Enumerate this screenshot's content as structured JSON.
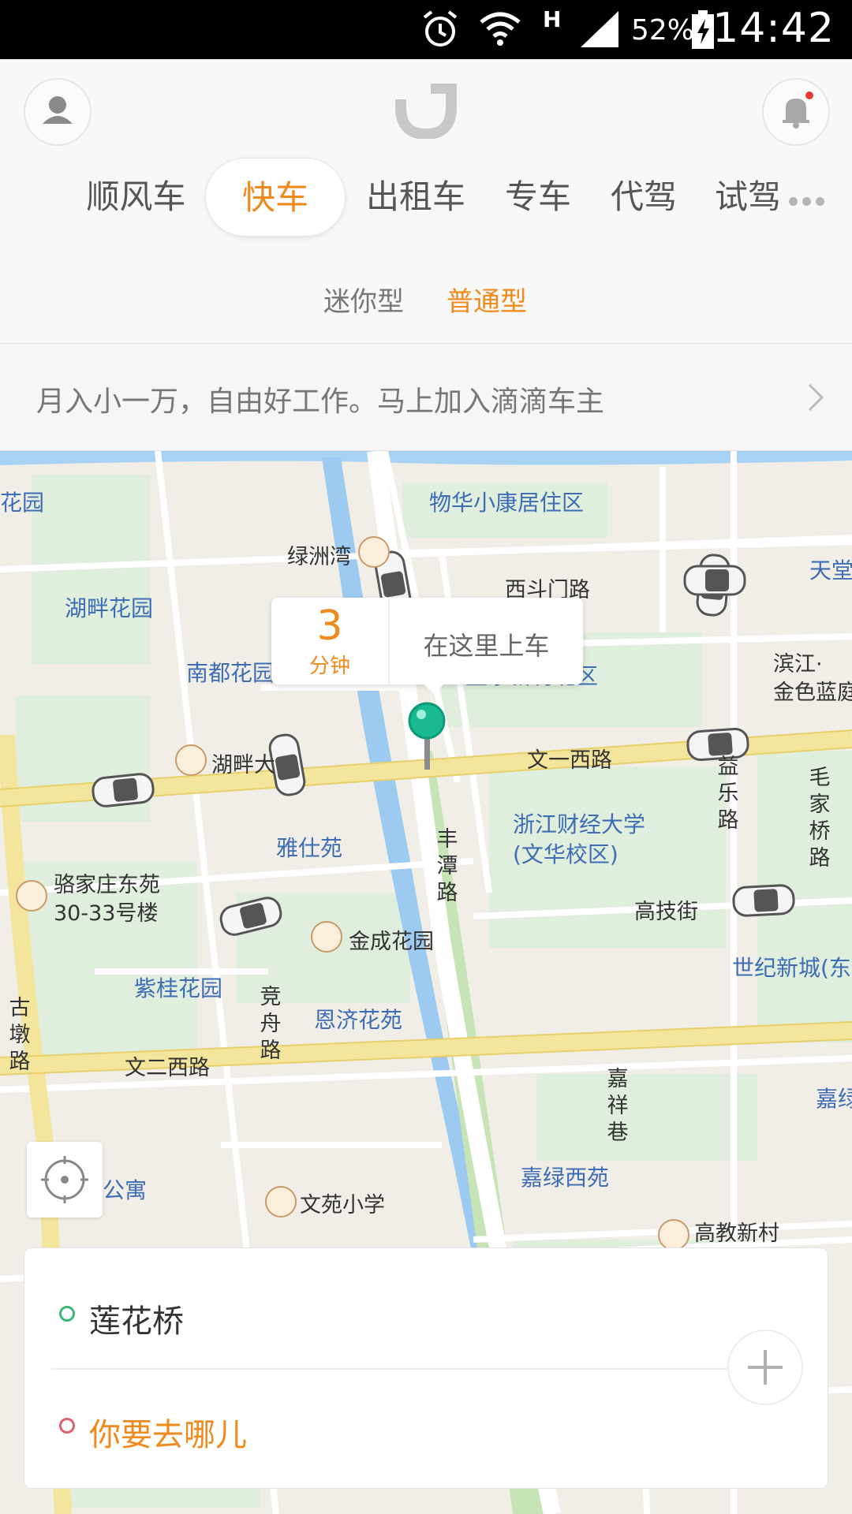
{
  "status_bar": {
    "time": "14:42",
    "battery": "52%",
    "network_type": "H"
  },
  "header": {
    "tabs": [
      {
        "label": "顺风车",
        "active": false
      },
      {
        "label": "快车",
        "active": true
      },
      {
        "label": "出租车",
        "active": false
      },
      {
        "label": "专车",
        "active": false
      },
      {
        "label": "代驾",
        "active": false
      },
      {
        "label": "试驾",
        "active": false
      }
    ],
    "subtabs": [
      {
        "label": "迷你型",
        "active": false
      },
      {
        "label": "普通型",
        "active": true
      }
    ],
    "accent_color": "#f08a1c",
    "notification_dot_color": "#e53935"
  },
  "banner": {
    "text": "月入小一万，自由好工作。马上加入滴滴车主"
  },
  "map": {
    "callout": {
      "minutes": "3",
      "unit": "分钟",
      "label": "在这里上车"
    },
    "labels": {
      "huayuan": "花园",
      "wuhua": "物华小康居住区",
      "lvzhouwan": "绿洲湾",
      "xidoumen": "西斗门路",
      "tiantang": "天堂",
      "hupan_hy": "湖畔花园",
      "nandu": "南都花园",
      "yile": "益乐新村北区",
      "binjiang": "滨江·",
      "jinse": "金色蓝庭",
      "hupan_da": "湖畔大",
      "wenyi": "文一西路",
      "yile_road": "益乐路",
      "maojia": "毛家桥路",
      "yashi": "雅仕苑",
      "zhecai1": "浙江财经大学",
      "zhecai2": "(文华校区)",
      "fengtan": "丰潭路",
      "luojia1": "骆家庄东苑",
      "luojia2": "30-33号楼",
      "gaoji": "高技街",
      "shiji": "世纪新城(东",
      "jincheng": "金成花园",
      "zigui": "紫桂花园",
      "jingzhou": "竞舟路",
      "enji": "恩济花苑",
      "gudun": "古墩路",
      "wener": "文二西路",
      "jiaxiang": "嘉祥巷",
      "jialv_r": "嘉绿",
      "gongyu": "公寓",
      "wenyuan": "文苑小学",
      "jialvxi": "嘉绿西苑",
      "gaojiao": "高教新村"
    }
  },
  "trip": {
    "origin": "莲花桥",
    "destination_placeholder": "你要去哪儿",
    "origin_dot_color": "#3bb878",
    "destination_dot_color": "#e0606e"
  }
}
